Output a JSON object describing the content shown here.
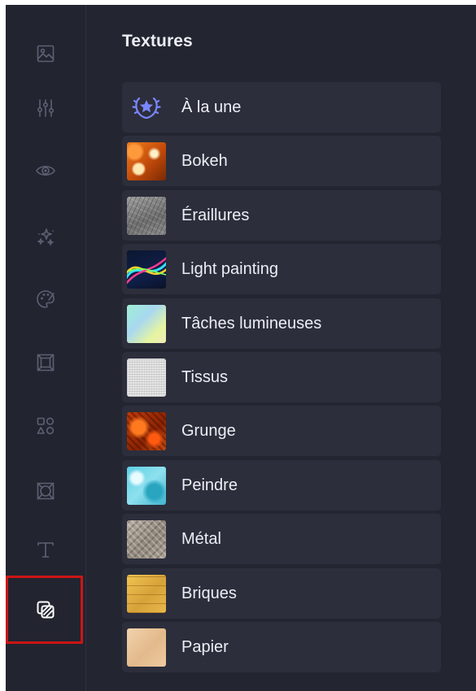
{
  "panel": {
    "title": "Textures"
  },
  "rail": {
    "items": [
      {
        "icon": "image-icon",
        "active": false
      },
      {
        "icon": "adjustments-sliders-icon",
        "active": false
      },
      {
        "icon": "eye-icon",
        "active": false
      },
      {
        "icon": "sparkles-effects-icon",
        "active": false
      },
      {
        "icon": "paint-palette-icon",
        "active": false
      },
      {
        "icon": "frame-icon",
        "active": false
      },
      {
        "icon": "shapes-icon",
        "active": false
      },
      {
        "icon": "overlay-pattern-icon",
        "active": false
      },
      {
        "icon": "text-icon",
        "active": false
      },
      {
        "icon": "textures-icon",
        "active": true
      }
    ]
  },
  "textures": {
    "items": [
      {
        "label": "À la une",
        "icon": "laurel-star-icon"
      },
      {
        "label": "Bokeh",
        "thumb": "bokeh"
      },
      {
        "label": "Éraillures",
        "thumb": "scratches"
      },
      {
        "label": "Light painting",
        "thumb": "light-painting"
      },
      {
        "label": "Tâches lumineuses",
        "thumb": "light-leaks"
      },
      {
        "label": "Tissus",
        "thumb": "fabric"
      },
      {
        "label": "Grunge",
        "thumb": "grunge"
      },
      {
        "label": "Peindre",
        "thumb": "paint"
      },
      {
        "label": "Métal",
        "thumb": "metal"
      },
      {
        "label": "Briques",
        "thumb": "bricks"
      },
      {
        "label": "Papier",
        "thumb": "paper"
      }
    ]
  },
  "colors": {
    "background": "#232531",
    "item_background": "#2c2e3b",
    "icon_inactive": "#5d6072",
    "icon_active": "#ffffff",
    "featured_icon": "#7a86ff",
    "highlight": "#cc1515"
  }
}
